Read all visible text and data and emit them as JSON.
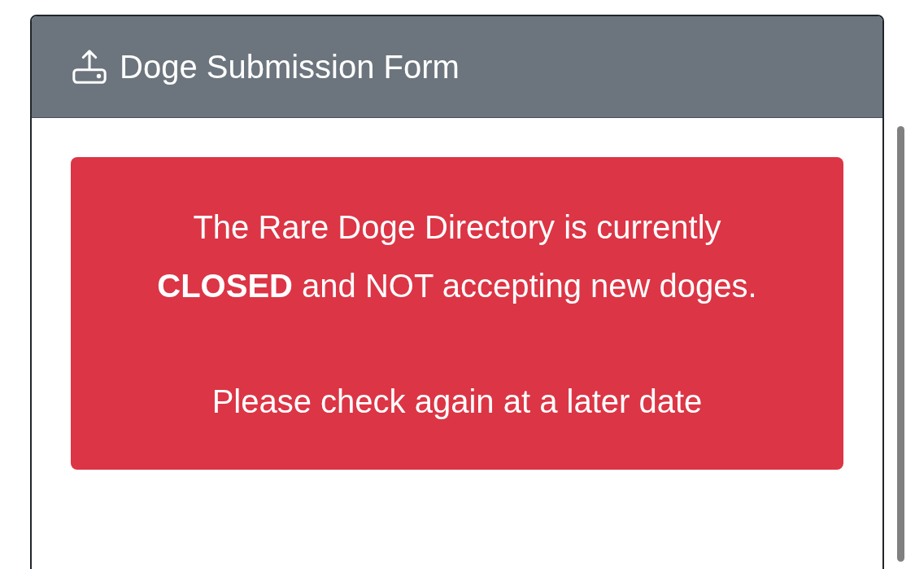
{
  "card": {
    "title": "Doge Submission Form"
  },
  "alert": {
    "paragraphs": [
      "The Rare Doge Directory is currently **CLOSED** and NOT accepting new doges.",
      "Please check again at a later date"
    ]
  }
}
